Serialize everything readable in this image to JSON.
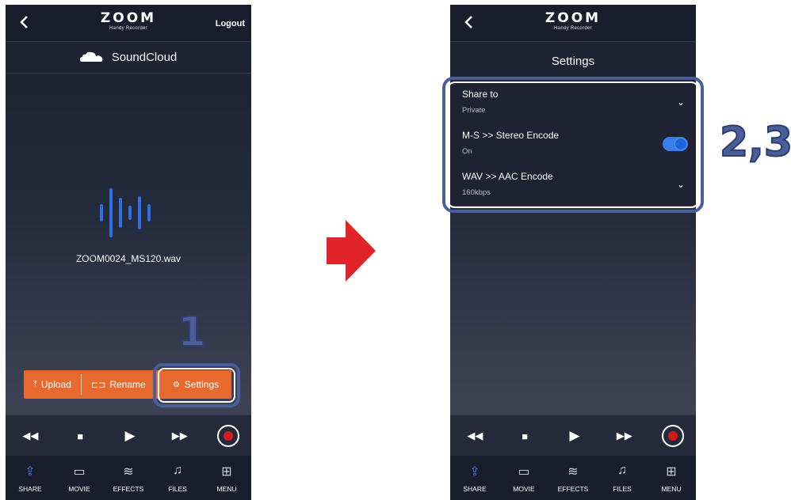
{
  "left_phone": {
    "logo": "ZOOM",
    "logo_sub": "Handy Recorder",
    "logout": "Logout",
    "service": "SoundCloud",
    "filename": "ZOOM0024_MS120.wav",
    "actions": {
      "upload": "Upload",
      "rename": "Rename",
      "settings": "Settings"
    }
  },
  "right_phone": {
    "logo": "ZOOM",
    "logo_sub": "Handy Recorder",
    "title": "Settings",
    "settings": [
      {
        "name": "Share to",
        "value": "Private",
        "control": "dropdown"
      },
      {
        "name": "M-S >> Stereo Encode",
        "value": "On",
        "control": "toggle"
      },
      {
        "name": "WAV >> AAC Encode",
        "value": "160kbps",
        "control": "dropdown"
      }
    ]
  },
  "tabs": [
    "SHARE",
    "MOVIE",
    "EFFECTS",
    "FILES",
    "MENU"
  ],
  "steps": {
    "first": "1",
    "second": "2,3"
  },
  "colors": {
    "accent_orange": "#e8692d",
    "active_blue": "#3a7ce8",
    "highlight": "#4a5e9a",
    "record_red": "#d61a1a",
    "arrow_red": "#e0242a"
  },
  "icons": [
    "back-chevron",
    "soundcloud-cloud",
    "waveform",
    "upload",
    "rename",
    "gear",
    "rewind",
    "stop",
    "play",
    "fast-forward",
    "record",
    "share",
    "movie",
    "effects",
    "files",
    "menu",
    "chevron-down"
  ]
}
